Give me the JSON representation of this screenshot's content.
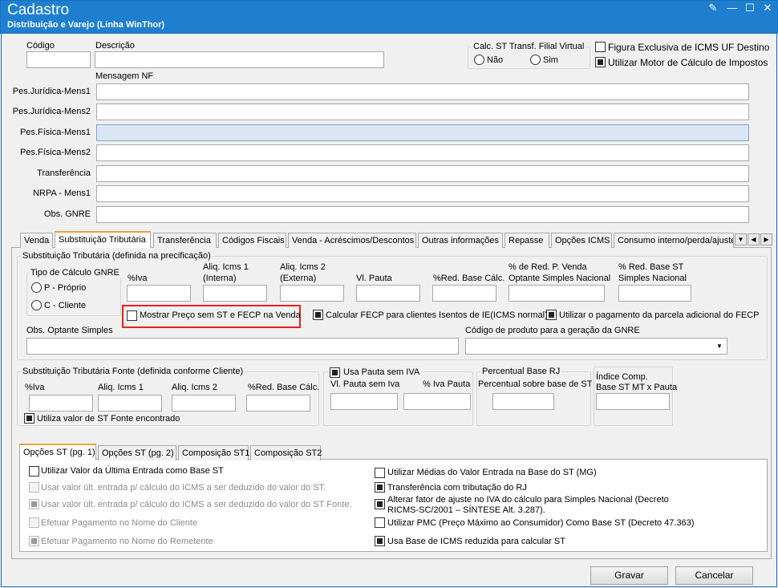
{
  "window": {
    "title": "Cadastro",
    "subtitle": "Distribuição e Varejo (Linha WinThor)"
  },
  "header": {
    "codigo_label": "Código",
    "descricao_label": "Descrição",
    "codigo_value": "",
    "descricao_value": "",
    "calc_st_group": "Calc. ST Transf. Filial Virtual",
    "radio_nao": "Não",
    "radio_sim": "Sim",
    "figura_exclusiva": "Figura Exclusiva de ICMS UF Destino",
    "utilizar_motor": "Utilizar Motor de Cálculo de Impostos",
    "mensagem_nf": "Mensagem NF"
  },
  "mensagens": [
    {
      "label": "Pes.Jurídica-Mens1",
      "value": ""
    },
    {
      "label": "Pes.Jurídica-Mens2",
      "value": ""
    },
    {
      "label": "Pes.Física-Mens1",
      "value": ""
    },
    {
      "label": "Pes.Física-Mens2",
      "value": ""
    },
    {
      "label": "Transferência",
      "value": ""
    },
    {
      "label": "NRPA - Mens1",
      "value": ""
    },
    {
      "label": "Obs. GNRE",
      "value": ""
    }
  ],
  "tabs": [
    "Venda",
    "Substituição Tributária",
    "Transferência",
    "Códigos Fiscais",
    "Venda - Acréscimos/Descontos",
    "Outras informações",
    "Repasse",
    "Opções ICMS",
    "Consumo interno/perda/ajuste"
  ],
  "st": {
    "group_title": "Substituição Tributária (definida na precificação)",
    "tipo_calculo": "Tipo de Cálculo GNRE",
    "proprio": "P - Próprio",
    "cliente": "C - Cliente",
    "iva": "%Iva",
    "aliq_icms1_l1": "Aliq. Icms 1",
    "aliq_icms1_l2": "(Interna)",
    "aliq_icms2_l1": "Aliq. Icms 2",
    "aliq_icms2_l2": "(Externa)",
    "vl_pauta": "Vl. Pauta",
    "red_base": "%Red. Base Cálc.",
    "red_venda_l1": "% de Red. P. Venda",
    "red_venda_l2": "Optante Simples Nacional",
    "red_simples_l1": "% Red. Base ST",
    "red_simples_l2": "Simples Nacional",
    "mostrar_preco": "Mostrar Preço sem ST e FECP na Venda",
    "calcular_fecp": "Calcular FECP para clientes Isentos de IE(ICMS normal)",
    "utilizar_pagamento": "Utilizar o pagamento da parcela adicional do FECP",
    "obs_optante": "Obs. Optante Simples",
    "codigo_gnre": "Código de produto para a geração da GNRE"
  },
  "st_fonte": {
    "group_title": "Substituição Tributária Fonte (definida conforme Cliente)",
    "iva": "%Iva",
    "aliq1": "Aliq. Icms 1",
    "aliq2": "Aliq. Icms 2",
    "red_base": "%Red. Base Cálc.",
    "utiliza_valor": "Utiliza valor de ST Fonte encontrado",
    "usa_pauta": "Usa Pauta sem IVA",
    "vl_pauta_sem_iva": "Vl. Pauta sem Iva",
    "iva_pauta": "% Iva Pauta",
    "percentual_rj": "Percentual Base RJ",
    "percentual_sobre": "Percentual sobre base de ST",
    "indice_l1": "Índice Comp.",
    "indice_l2": "Base ST MT x Pauta"
  },
  "subtabs": [
    "Opções ST (pg. 1)",
    "Opções ST (pg. 2)",
    "Composição ST1",
    "Composição ST2"
  ],
  "opcoes_left": [
    {
      "label": "Utilizar Valor da Última Entrada como Base ST",
      "checked": false,
      "enabled": true
    },
    {
      "label": "Usar valor últ. entrada p/ cálculo do ICMS a ser deduzido do valor do ST.",
      "checked": false,
      "enabled": false
    },
    {
      "label": "Usar valor últ. entrada p/ cálculo do ICMS a ser deduzido do valor do ST Fonte.",
      "checked": true,
      "enabled": false
    },
    {
      "label": "Efetuar Pagamento no Nome do Cliente",
      "checked": false,
      "enabled": false
    },
    {
      "label": "Efetuar Pagamento no Nome do Remetente",
      "checked": true,
      "enabled": false
    }
  ],
  "opcoes_right": [
    {
      "label": "Utilizar Médias do Valor Entrada na Base do ST (MG)",
      "checked": false
    },
    {
      "label": "Transferência com tributação do RJ",
      "checked": true
    },
    {
      "label": "Alterar fator de ajuste no IVA do cálculo para Simples Nacional (Decreto",
      "label2": "RICMS-SC/2001 – SÍNTESE Alt. 3.287).",
      "checked": true
    },
    {
      "label": "Utilizar PMC (Preço Máximo ao Consumidor) Como Base ST (Decreto 47.363)",
      "checked": false
    },
    {
      "label": "Usa Base de ICMS reduzida para calcular ST",
      "checked": true
    }
  ],
  "buttons": {
    "gravar": "Gravar",
    "cancelar": "Cancelar"
  },
  "colors": {
    "titlebar": "#1e7fd0",
    "highlight": "#e8201c",
    "focus_field": "#dbe6f4"
  }
}
